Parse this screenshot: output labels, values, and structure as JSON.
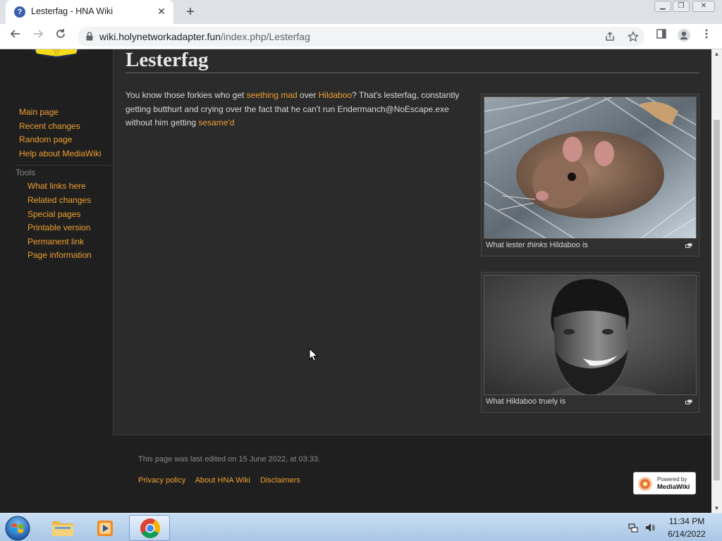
{
  "browser": {
    "tab_title": "Lesterfag - HNA Wiki",
    "url_host": "wiki.holynetworkadapter.fun",
    "url_path": "/index.php/Lesterfag"
  },
  "sidebar": {
    "navigation": [
      "Main page",
      "Recent changes",
      "Random page",
      "Help about MediaWiki"
    ],
    "tools_heading": "Tools",
    "tools": [
      "What links here",
      "Related changes",
      "Special pages",
      "Printable version",
      "Permanent link",
      "Page information"
    ]
  },
  "article": {
    "title": "Lesterfag",
    "p_before_link1": "You know those forkies who get ",
    "link1": "seething mad",
    "p_mid1": " over ",
    "link2": "Hildaboo",
    "p_mid2": "? That's lesterfag, constantly getting butthurt and crying over the fact that he can't run Endermanch@NoEscape.exe without him getting ",
    "link3": "sesame'd",
    "images": [
      {
        "caption_before": "What lester ",
        "caption_em": "thinks",
        "caption_after": " Hildaboo is"
      },
      {
        "caption_before": "What Hildaboo truely is",
        "caption_em": "",
        "caption_after": ""
      }
    ]
  },
  "footer": {
    "last_edited": "This page was last edited on 15 June 2022, at 03:33.",
    "links": [
      "Privacy policy",
      "About HNA Wiki",
      "Disclaimers"
    ],
    "powered_small": "Powered by",
    "powered_big": "MediaWiki"
  },
  "taskbar": {
    "time": "11:34 PM",
    "date": "6/14/2022"
  }
}
